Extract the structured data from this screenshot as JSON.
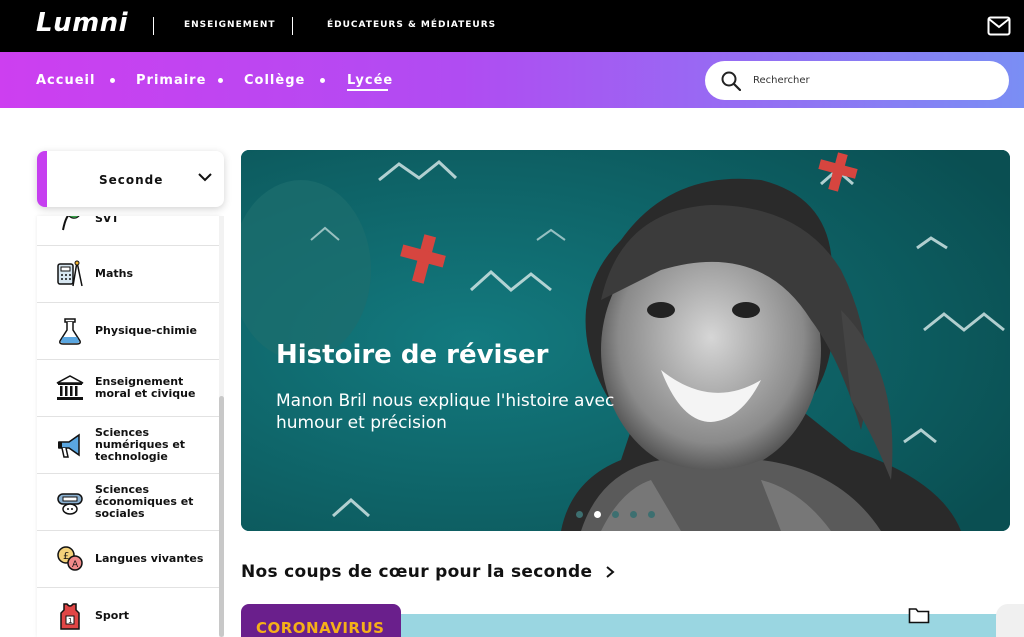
{
  "topbar": {
    "logo": "Lumni",
    "links": [
      "ENSEIGNEMENT",
      "ÉDUCATEURS & MÉDIATEURS"
    ]
  },
  "nav": {
    "items": [
      "Accueil",
      "Primaire",
      "Collège",
      "Lycée"
    ],
    "active": "Lycée",
    "search_placeholder": "Rechercher"
  },
  "level": {
    "selected": "Seconde"
  },
  "subjects": [
    {
      "label": "SVT",
      "icon": "plant-icon"
    },
    {
      "label": "Maths",
      "icon": "calculator-compass-icon"
    },
    {
      "label": "Physique-chimie",
      "icon": "test-tube-icon"
    },
    {
      "label": "Enseignement moral et civique",
      "icon": "institution-icon"
    },
    {
      "label": "Sciences numériques et technologie",
      "icon": "megaphone-icon"
    },
    {
      "label": "Sciences économiques et sociales",
      "icon": "piggy-bank-icon"
    },
    {
      "label": "Langues vivantes",
      "icon": "speech-bubbles-icon"
    },
    {
      "label": "Sport",
      "icon": "jersey-icon"
    }
  ],
  "hero": {
    "title": "Histoire de réviser",
    "subtitle": "Manon Bril nous explique l'histoire avec humour et précision",
    "slide_count": 5,
    "active_slide": 2
  },
  "section": {
    "title": "Nos coups de cœur pour la seconde"
  },
  "card": {
    "tag": "CORONAVIRUS"
  },
  "colors": {
    "brand_purple": "#c63ff0",
    "nav_gradient_end": "#7a8ef4",
    "hero_teal": "#0c6468",
    "card_tag_bg": "#6a1f8c",
    "card_tag_text": "#f5b018"
  }
}
